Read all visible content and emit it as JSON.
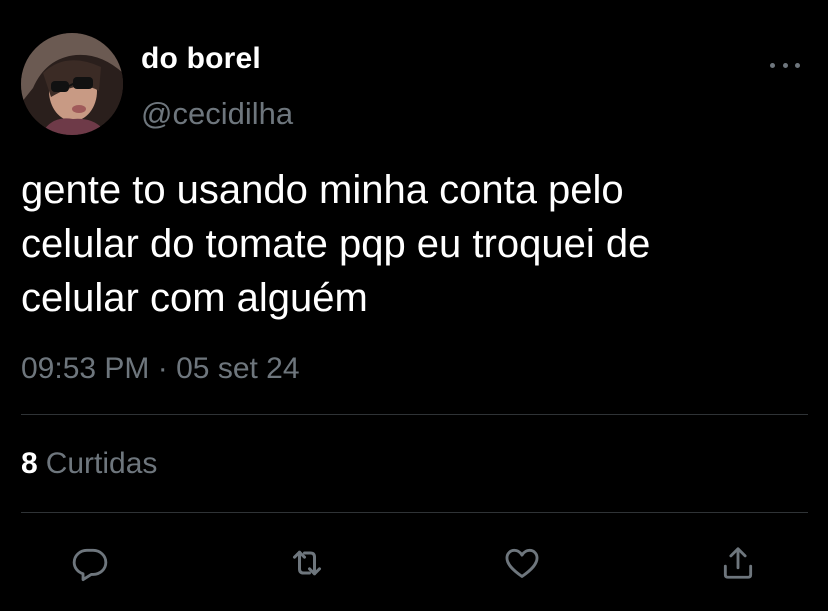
{
  "tweet": {
    "display_name": "do borel",
    "handle": "@cecidilha",
    "text": "gente to usando minha conta pelo\ncelular do tomate pqp eu troquei de\ncelular com alguém",
    "time": "09:53 PM",
    "separator": "·",
    "date": "05 set 24",
    "likes_count": "8",
    "likes_label": "Curtidas"
  },
  "icons": {
    "more": "more-horizontal-icon",
    "reply": "reply-icon",
    "retweet": "retweet-icon",
    "like": "heart-icon",
    "share": "share-icon"
  },
  "colors": {
    "background": "#000000",
    "primary_text": "#ffffff",
    "secondary_text": "#6e767d",
    "divider": "#2f3336"
  }
}
